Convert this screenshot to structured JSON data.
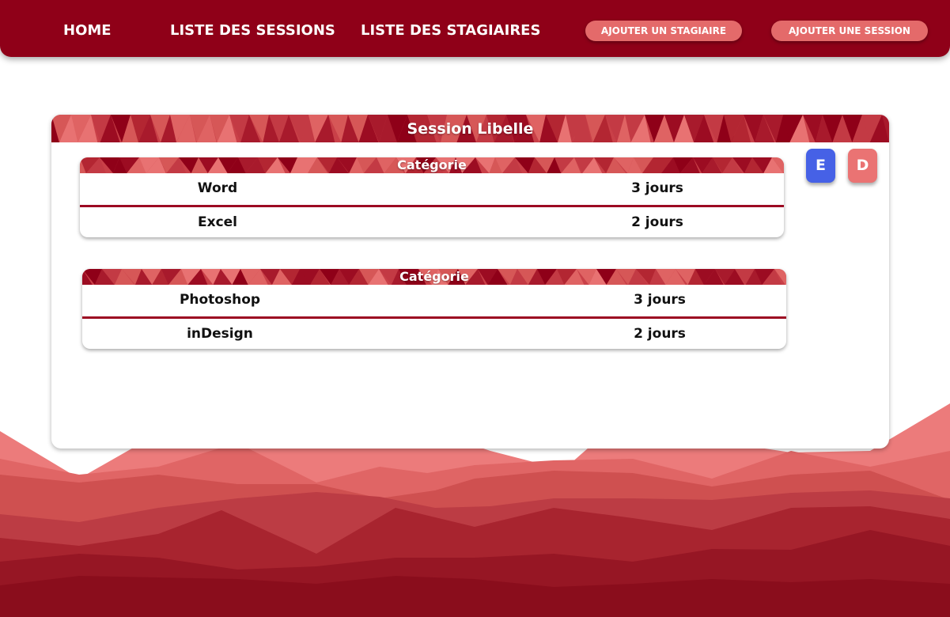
{
  "nav": {
    "home": "HOME",
    "sessions": "LISTE DES SESSIONS",
    "trainees": "LISTE DES STAGIAIRES",
    "add_trainee": "AJOUTER UN STAGIAIRE",
    "add_session": "AJOUTER UNE SESSION"
  },
  "session": {
    "title": "Session Libelle",
    "edit_label": "E",
    "delete_label": "D",
    "categories": [
      {
        "title": "Catégorie",
        "modules": [
          {
            "name": "Word",
            "duration": "3 jours"
          },
          {
            "name": "Excel",
            "duration": "2 jours"
          }
        ]
      },
      {
        "title": "Catégorie",
        "modules": [
          {
            "name": "Photoshop",
            "duration": "3 jours"
          },
          {
            "name": "inDesign",
            "duration": "2 jours"
          }
        ]
      }
    ]
  },
  "colors": {
    "brand_dark": "#8f0018",
    "brand_mid": "#c9414a",
    "brand_light": "#e46a6a",
    "edit_button": "#4661e6",
    "delete_button": "#ea7373"
  }
}
